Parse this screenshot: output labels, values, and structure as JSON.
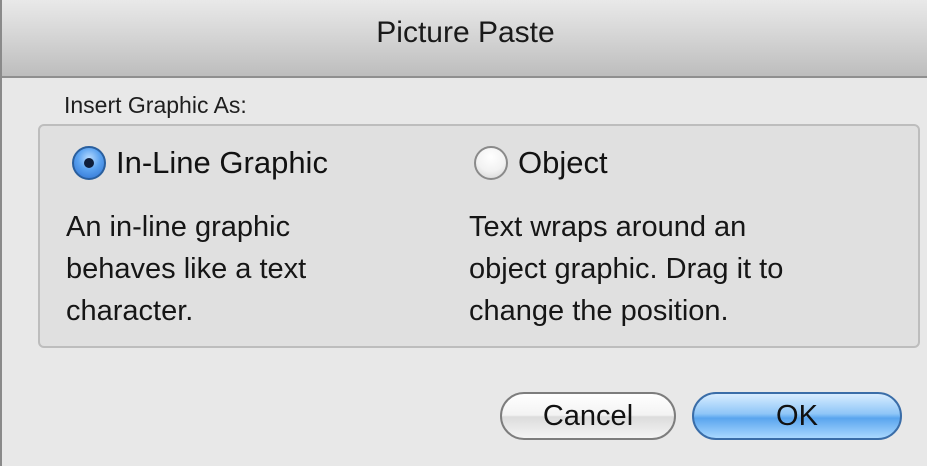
{
  "dialog": {
    "title": "Picture Paste",
    "group_label": "Insert Graphic As:",
    "options": [
      {
        "label": "In-Line Graphic",
        "selected": true,
        "description_lines": [
          "An in-line graphic",
          "behaves like a text",
          "character."
        ]
      },
      {
        "label": "Object",
        "selected": false,
        "description_lines": [
          "Text wraps around an",
          "object graphic. Drag it to",
          "change the position."
        ]
      }
    ],
    "buttons": {
      "cancel": "Cancel",
      "ok": "OK"
    }
  },
  "colors": {
    "default_button": "#5aa5ee",
    "selected_radio": "#2c6fd0"
  }
}
